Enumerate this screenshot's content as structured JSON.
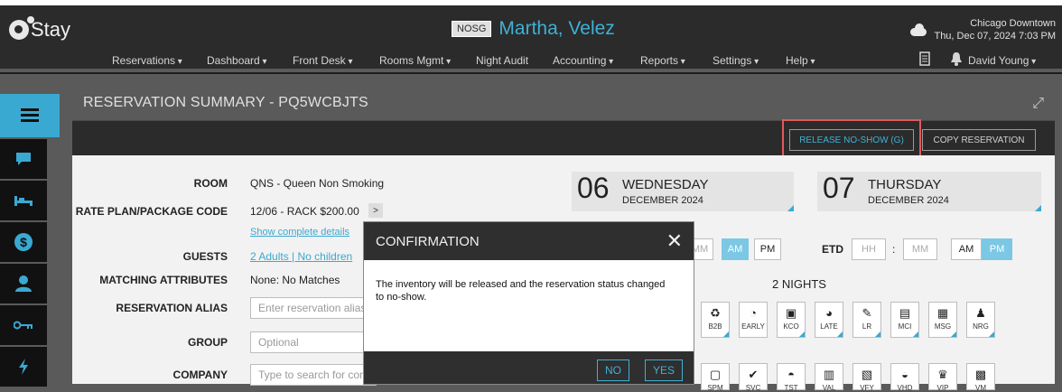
{
  "app": {
    "name": "Stay"
  },
  "header": {
    "badge": "NOSG",
    "guest_name": "Martha, Velez",
    "property": "Chicago Downtown",
    "datetime": "Thu, Dec 07, 2024 7:03 PM"
  },
  "nav": {
    "items": [
      "Reservations",
      "Dashboard",
      "Front Desk",
      "Rooms Mgmt",
      "Night Audit",
      "Accounting",
      "Reports",
      "Settings",
      "Help"
    ],
    "user": "David Young"
  },
  "panel": {
    "title": "RESERVATION SUMMARY - PQ5WCBJTS",
    "release_button": "RELEASE NO-SHOW (G)",
    "copy_button": "COPY RESERVATION"
  },
  "form": {
    "room_label": "ROOM",
    "room_value": "QNS - Queen Non Smoking",
    "rate_label": "RATE PLAN/PACKAGE CODE",
    "rate_value": "12/06 - RACK $200.00",
    "show_details": "Show complete details",
    "guests_label": "GUESTS",
    "guests_value": "2 Adults | No children",
    "matching_label": "MATCHING ATTRIBUTES",
    "matching_value": "None: No Matches",
    "alias_label": "RESERVATION ALIAS",
    "alias_placeholder": "Enter reservation alias",
    "group_label": "GROUP",
    "group_placeholder": "Optional",
    "company_label": "COMPANY",
    "company_placeholder": "Type to search for company"
  },
  "arrival": {
    "day": "06",
    "weekday": "WEDNESDAY",
    "month": "DECEMBER 2024"
  },
  "departure": {
    "day": "07",
    "weekday": "THURSDAY",
    "month": "DECEMBER 2024"
  },
  "times": {
    "etd_label": "ETD",
    "hh": "HH",
    "mm": "MM",
    "sep": ":",
    "am": "AM",
    "pm": "PM"
  },
  "nights": "2 NIGHTS",
  "tags_row1": [
    "B2B",
    "EARLY",
    "KCO",
    "LATE",
    "LR",
    "MCI",
    "MSG",
    "NRG"
  ],
  "tags_row2": [
    "SPM",
    "SVC",
    "TST",
    "VAL",
    "VFY",
    "VHD",
    "VIP",
    "VM"
  ],
  "modal": {
    "title": "CONFIRMATION",
    "message": "The inventory will be released and the reservation status changed to no-show.",
    "no": "NO",
    "yes": "YES"
  }
}
